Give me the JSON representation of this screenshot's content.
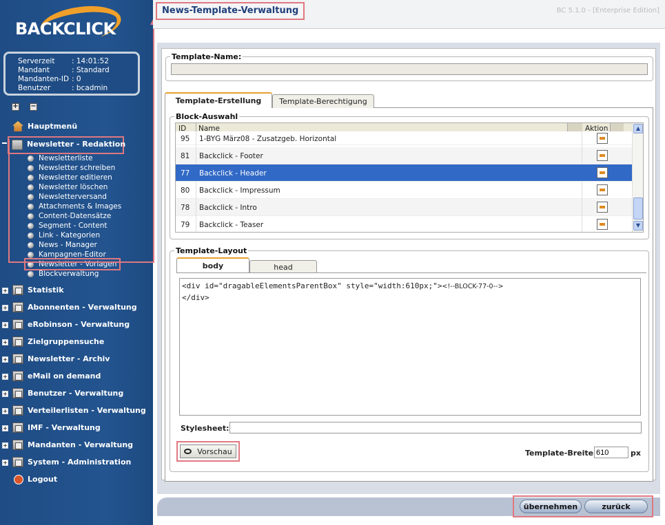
{
  "app": {
    "title": "News-Template-Verwaltung",
    "version": "BC 5.1.0 - [Enterprise Edition]",
    "logo": "BACKCLICK"
  },
  "info": [
    {
      "k": "Serverzeit",
      "v": ": 14:01:52"
    },
    {
      "k": "Mandant",
      "v": ": Standard"
    },
    {
      "k": "Mandanten-ID",
      "v": ": 0"
    },
    {
      "k": "Benutzer",
      "v": ": bcadmin"
    }
  ],
  "nav": {
    "hauptmenu": "Hauptmenü",
    "redaktion": "Newsletter - Redaktion",
    "subitems": [
      "Newsletterliste",
      "Newsletter schreiben",
      "Newsletter editieren",
      "Newsletter löschen",
      "Newsletterversand",
      "Attachments & Images",
      "Content-Datensätze",
      "Segment - Content",
      "Link - Kategorien",
      "News - Manager",
      "Kampagnen-Editor",
      "Newsletter - Vorlagen",
      "Blockverwaltung"
    ],
    "items": [
      "Statistik",
      "Abonnenten - Verwaltung",
      "eRobinson - Verwaltung",
      "Zielgruppensuche",
      "Newsletter - Archiv",
      "eMail on demand",
      "Benutzer - Verwaltung",
      "Verteilerlisten - Verwaltung",
      "IMF - Verwaltung",
      "Mandanten - Verwaltung",
      "System - Administration"
    ],
    "logout": "Logout"
  },
  "form": {
    "template_name_label": "Template-Name:",
    "template_name_value": "",
    "tabs": [
      "Template-Erstellung",
      "Template-Berechtigung"
    ],
    "block_legend": "Block-Auswahl",
    "grid_headers": {
      "id": "ID",
      "name": "Name",
      "action": "Aktion"
    },
    "rows": [
      {
        "id": "95",
        "name": "1-BYG März08 - Zusatzgeb. Horizontal"
      },
      {
        "id": "81",
        "name": "Backclick - Footer"
      },
      {
        "id": "77",
        "name": "Backclick - Header"
      },
      {
        "id": "80",
        "name": "Backclick - Impressum"
      },
      {
        "id": "78",
        "name": "Backclick - Intro"
      },
      {
        "id": "79",
        "name": "Backclick - Teaser"
      }
    ],
    "layout_legend": "Template-Layout",
    "layout_tabs": [
      "body",
      "head"
    ],
    "code_line1": "<div id=\"dragableElementsParentBox\" style=\"width:610px;\">",
    "code_comment": "<!--BLOCK-77-0-->",
    "code_line2": "</div>",
    "stylesheet_label": "Stylesheet:",
    "stylesheet_value": "",
    "preview_label": "Vorschau",
    "width_label": "Template-Breite:",
    "width_value": "610",
    "width_unit": "px"
  },
  "footer": {
    "apply": "übernehmen",
    "back": "zurück"
  }
}
